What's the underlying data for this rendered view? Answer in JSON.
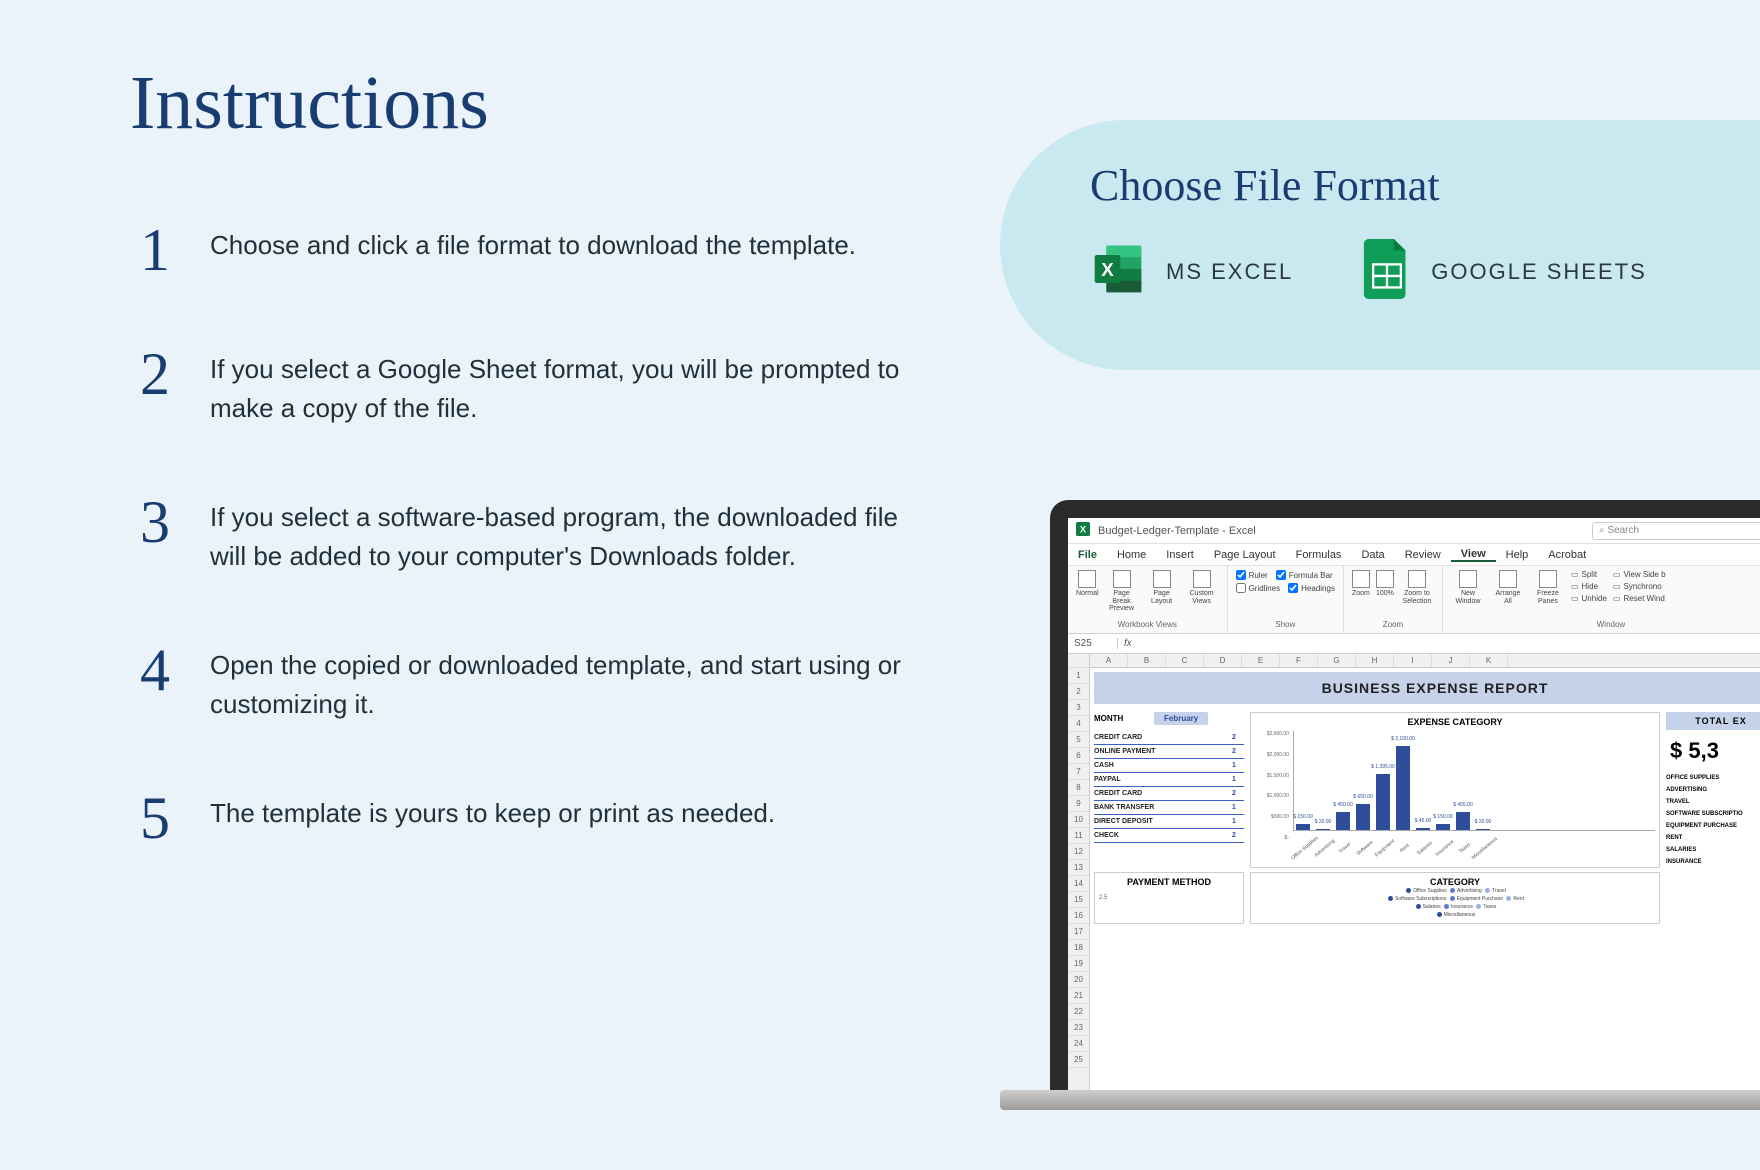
{
  "title": "Instructions",
  "steps": [
    {
      "num": "1",
      "text": "Choose and click a file format to download the template."
    },
    {
      "num": "2",
      "text": "If you select a Google Sheet format, you will be prompted to make a copy of the file."
    },
    {
      "num": "3",
      "text": "If you select a software-based program, the downloaded file will be added to your computer's Downloads folder."
    },
    {
      "num": "4",
      "text": "Open the copied or downloaded template, and start using or customizing it."
    },
    {
      "num": "5",
      "text": "The template is yours to keep or print as needed."
    }
  ],
  "format_panel": {
    "title": "Choose File Format",
    "options": [
      {
        "label": "MS EXCEL"
      },
      {
        "label": "GOOGLE SHEETS"
      }
    ]
  },
  "excel": {
    "filename": "Budget-Ledger-Template  -  Excel",
    "search_placeholder": "Search",
    "menus": [
      "File",
      "Home",
      "Insert",
      "Page Layout",
      "Formulas",
      "Data",
      "Review",
      "View",
      "Help",
      "Acrobat"
    ],
    "active_menu": "View",
    "ribbon": {
      "workbook_views": {
        "label": "Workbook Views",
        "buttons": [
          "Normal",
          "Page Break Preview",
          "Page Layout",
          "Custom Views"
        ]
      },
      "show": {
        "label": "Show",
        "checks": [
          {
            "label": "Ruler",
            "on": true
          },
          {
            "label": "Formula Bar",
            "on": true
          },
          {
            "label": "Gridlines",
            "on": false
          },
          {
            "label": "Headings",
            "on": true
          }
        ]
      },
      "zoom": {
        "label": "Zoom",
        "buttons": [
          "Zoom",
          "100%",
          "Zoom to Selection"
        ]
      },
      "window": {
        "label": "Window",
        "buttons": [
          "New Window",
          "Arrange All",
          "Freeze Panes"
        ],
        "right": [
          "Split",
          "Hide",
          "Unhide"
        ],
        "far": [
          "View Side b",
          "Synchrono",
          "Reset Wind"
        ]
      }
    },
    "cell_ref": "S25",
    "columns": [
      "A",
      "B",
      "C",
      "D",
      "E",
      "F",
      "G",
      "H",
      "I",
      "J",
      "K"
    ],
    "rows": [
      "1",
      "2",
      "3",
      "4",
      "5",
      "6",
      "7",
      "8",
      "9",
      "10",
      "11",
      "12",
      "13",
      "14",
      "15",
      "16",
      "17",
      "18",
      "19",
      "20",
      "21",
      "22",
      "23",
      "24",
      "25"
    ],
    "report_title": "BUSINESS EXPENSE REPORT",
    "month_label": "MONTH",
    "month_value": "February",
    "payment_rows": [
      {
        "label": "CREDIT CARD",
        "count": "2"
      },
      {
        "label": "ONLINE PAYMENT",
        "count": "2"
      },
      {
        "label": "CASH",
        "count": "1"
      },
      {
        "label": "PAYPAL",
        "count": "1"
      },
      {
        "label": "CREDIT CARD",
        "count": "2"
      },
      {
        "label": "BANK TRANSFER",
        "count": "1"
      },
      {
        "label": "DIRECT DEPOSIT",
        "count": "1"
      },
      {
        "label": "CHECK",
        "count": "2"
      }
    ],
    "expense_chart_title": "EXPENSE CATEGORY",
    "total_label": "TOTAL EX",
    "total_amount": "$    5,3",
    "side_categories": [
      "OFFICE SUPPLIES",
      "ADVERTISING",
      "TRAVEL",
      "SOFTWARE SUBSCRIPTIO",
      "EQUIPMENT PURCHASE",
      "RENT",
      "SALARIES",
      "INSURANCE"
    ],
    "payment_method_title": "PAYMENT METHOD",
    "payment_method_tick": "2.5",
    "category_title": "CATEGORY",
    "legend_items": [
      "Office Supplies",
      "Advertising",
      "Travel",
      "Software Subscriptions",
      "Equipment Purchase",
      "Rent",
      "Salaries",
      "Insurance",
      "Taxes",
      "Miscellaneous"
    ]
  },
  "chart_data": {
    "type": "bar",
    "title": "EXPENSE CATEGORY",
    "ylabel": "",
    "ylim": [
      0,
      2500
    ],
    "yticks": [
      "$2,500.00",
      "$2,000.00",
      "$1,500.00",
      "$1,000.00",
      "$500.00",
      "$-"
    ],
    "categories": [
      "Office Supplies",
      "Advertising",
      "Travel",
      "Software",
      "Equipment",
      "Rent",
      "Salaries",
      "Insurance",
      "Taxes",
      "Miscellaneous"
    ],
    "values": [
      150,
      20,
      450,
      650,
      1395,
      2100,
      45,
      150,
      455,
      20
    ],
    "datalabels": [
      "$ 150.00",
      "$ 20.00",
      "$ 450.00",
      "$ 650.00",
      "$ 1,395.00",
      "$ 2,100.00",
      "$ 45.00",
      "$ 150.00",
      "$ 455.00",
      "$ 20.00"
    ]
  }
}
